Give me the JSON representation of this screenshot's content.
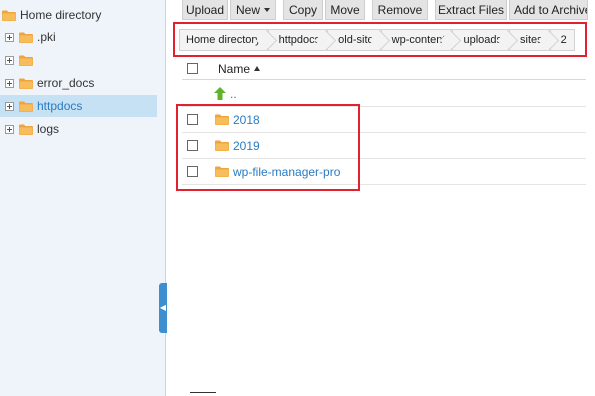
{
  "sidebar": {
    "root_label": "Home directory",
    "items": [
      {
        "label": ".pki",
        "selected": false
      },
      {
        "label": "",
        "selected": false
      },
      {
        "label": "error_docs",
        "selected": false
      },
      {
        "label": "httpdocs",
        "selected": true
      },
      {
        "label": "logs",
        "selected": false
      }
    ]
  },
  "toolbar": {
    "upload_label": "Upload",
    "new_label": "New",
    "copy_label": "Copy",
    "move_label": "Move",
    "remove_label": "Remove",
    "extract_label": "Extract Files",
    "archive_label": "Add to Archive"
  },
  "breadcrumb": [
    "Home directory",
    "httpdocs",
    "old-site",
    "wp-content",
    "uploads",
    "sites",
    "2"
  ],
  "file_list": {
    "column_name": "Name",
    "sort": "ascending",
    "parent_label": "..",
    "rows": [
      {
        "name": "2018",
        "type": "folder"
      },
      {
        "name": "2019",
        "type": "folder"
      },
      {
        "name": "wp-file-manager-pro",
        "type": "folder"
      }
    ]
  },
  "colors": {
    "highlight_border": "#e3202f",
    "link": "#2a7bc2",
    "folder": "#f0a53c",
    "selected_bg": "#c6e0f4",
    "sidebar_bg": "#eef4fa"
  }
}
